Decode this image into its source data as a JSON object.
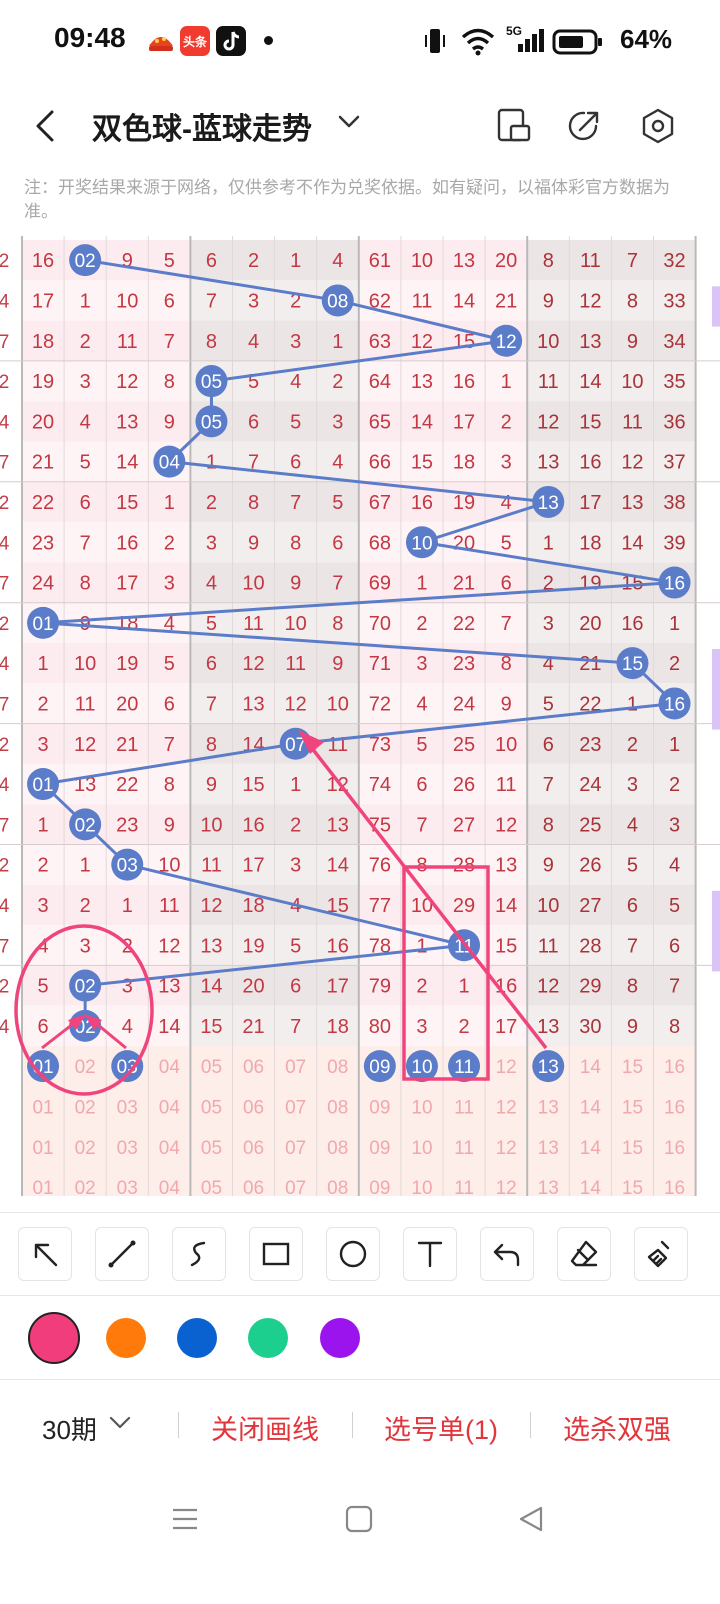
{
  "status_bar": {
    "time": "09:48",
    "battery_text": "64%",
    "network": "5G",
    "app_icons": [
      "pizza-app-icon",
      "toutiao-app-icon",
      "tiktok-app-icon"
    ],
    "toutiao_label": "头条"
  },
  "header": {
    "title": "双色球-蓝球走势"
  },
  "notice": "注：开奖结果来源于网络，仅供参考不作为兑奖依据。如有疑问，以福体彩官方数据为准。",
  "grid": {
    "left_edge": [
      "2",
      "4",
      "7",
      "2",
      "4",
      "7",
      "2",
      "4",
      "7",
      "2",
      "4",
      "7",
      "2",
      "4",
      "7",
      "2",
      "4",
      "7",
      "2",
      "4"
    ],
    "rows": [
      [
        "16",
        "02",
        "9",
        "5",
        "6",
        "2",
        "1",
        "4",
        "61",
        "10",
        "13",
        "20",
        "8",
        "11",
        "7",
        "32"
      ],
      [
        "17",
        "1",
        "10",
        "6",
        "7",
        "3",
        "2",
        "08",
        "62",
        "11",
        "14",
        "21",
        "9",
        "12",
        "8",
        "33"
      ],
      [
        "18",
        "2",
        "11",
        "7",
        "8",
        "4",
        "3",
        "1",
        "63",
        "12",
        "15",
        "12",
        "10",
        "13",
        "9",
        "34"
      ],
      [
        "19",
        "3",
        "12",
        "8",
        "05",
        "5",
        "4",
        "2",
        "64",
        "13",
        "16",
        "1",
        "11",
        "14",
        "10",
        "35"
      ],
      [
        "20",
        "4",
        "13",
        "9",
        "05",
        "6",
        "5",
        "3",
        "65",
        "14",
        "17",
        "2",
        "12",
        "15",
        "11",
        "36"
      ],
      [
        "21",
        "5",
        "14",
        "04",
        "1",
        "7",
        "6",
        "4",
        "66",
        "15",
        "18",
        "3",
        "13",
        "16",
        "12",
        "37"
      ],
      [
        "22",
        "6",
        "15",
        "1",
        "2",
        "8",
        "7",
        "5",
        "67",
        "16",
        "19",
        "4",
        "13",
        "17",
        "13",
        "38"
      ],
      [
        "23",
        "7",
        "16",
        "2",
        "3",
        "9",
        "8",
        "6",
        "68",
        "10",
        "20",
        "5",
        "1",
        "18",
        "14",
        "39"
      ],
      [
        "24",
        "8",
        "17",
        "3",
        "4",
        "10",
        "9",
        "7",
        "69",
        "1",
        "21",
        "6",
        "2",
        "19",
        "15",
        "16"
      ],
      [
        "01",
        "9",
        "18",
        "4",
        "5",
        "11",
        "10",
        "8",
        "70",
        "2",
        "22",
        "7",
        "3",
        "20",
        "16",
        "1"
      ],
      [
        "1",
        "10",
        "19",
        "5",
        "6",
        "12",
        "11",
        "9",
        "71",
        "3",
        "23",
        "8",
        "4",
        "21",
        "15",
        "2"
      ],
      [
        "2",
        "11",
        "20",
        "6",
        "7",
        "13",
        "12",
        "10",
        "72",
        "4",
        "24",
        "9",
        "5",
        "22",
        "1",
        "16"
      ],
      [
        "3",
        "12",
        "21",
        "7",
        "8",
        "14",
        "07",
        "11",
        "73",
        "5",
        "25",
        "10",
        "6",
        "23",
        "2",
        "1"
      ],
      [
        "01",
        "13",
        "22",
        "8",
        "9",
        "15",
        "1",
        "12",
        "74",
        "6",
        "26",
        "11",
        "7",
        "24",
        "3",
        "2"
      ],
      [
        "1",
        "02",
        "23",
        "9",
        "10",
        "16",
        "2",
        "13",
        "75",
        "7",
        "27",
        "12",
        "8",
        "25",
        "4",
        "3"
      ],
      [
        "2",
        "1",
        "03",
        "10",
        "11",
        "17",
        "3",
        "14",
        "76",
        "8",
        "28",
        "13",
        "9",
        "26",
        "5",
        "4"
      ],
      [
        "3",
        "2",
        "1",
        "11",
        "12",
        "18",
        "4",
        "15",
        "77",
        "10",
        "29",
        "14",
        "10",
        "27",
        "6",
        "5"
      ],
      [
        "4",
        "3",
        "2",
        "12",
        "13",
        "19",
        "5",
        "16",
        "78",
        "1",
        "11",
        "15",
        "11",
        "28",
        "7",
        "6"
      ],
      [
        "5",
        "02",
        "3",
        "13",
        "14",
        "20",
        "6",
        "17",
        "79",
        "2",
        "1",
        "16",
        "12",
        "29",
        "8",
        "7"
      ],
      [
        "6",
        "02",
        "4",
        "14",
        "15",
        "21",
        "7",
        "18",
        "80",
        "3",
        "2",
        "17",
        "13",
        "30",
        "9",
        "8"
      ]
    ],
    "ball_cols": [
      1,
      7,
      11,
      4,
      4,
      3,
      12,
      9,
      15,
      0,
      14,
      15,
      6,
      0,
      1,
      2,
      -1,
      10,
      1,
      1
    ],
    "selection_rows": [
      [
        "01",
        "02",
        "03",
        "04",
        "05",
        "06",
        "07",
        "08",
        "09",
        "10",
        "11",
        "12",
        "13",
        "14",
        "15",
        "16"
      ],
      [
        "01",
        "02",
        "03",
        "04",
        "05",
        "06",
        "07",
        "08",
        "09",
        "10",
        "11",
        "12",
        "13",
        "14",
        "15",
        "16"
      ],
      [
        "01",
        "02",
        "03",
        "04",
        "05",
        "06",
        "07",
        "08",
        "09",
        "10",
        "11",
        "12",
        "13",
        "14",
        "15",
        "16"
      ],
      [
        "01",
        "02",
        "03",
        "04",
        "05",
        "06",
        "07",
        "08",
        "09",
        "10",
        "11",
        "12",
        "13",
        "14",
        "15",
        "16"
      ]
    ],
    "selected_numbers": [
      "01",
      "03",
      "09",
      "10",
      "11",
      "13"
    ]
  },
  "colors": {
    "ball_blue": "#5b7cc9",
    "annotation_pink": "#f0447c",
    "swatches": [
      "#f23d7c",
      "#ff7a0a",
      "#0a62d1",
      "#1ccf8e",
      "#9b14ee"
    ]
  },
  "drawing_tools": [
    "arrow-tool",
    "line-tool",
    "curve-tool",
    "rectangle-tool",
    "circle-tool",
    "text-tool",
    "undo-tool",
    "eraser-tool",
    "clear-tool"
  ],
  "bottom": {
    "period": "30期",
    "close_draw": "关闭画线",
    "pick_list": "选号单(1)",
    "kill": "选杀双强"
  }
}
